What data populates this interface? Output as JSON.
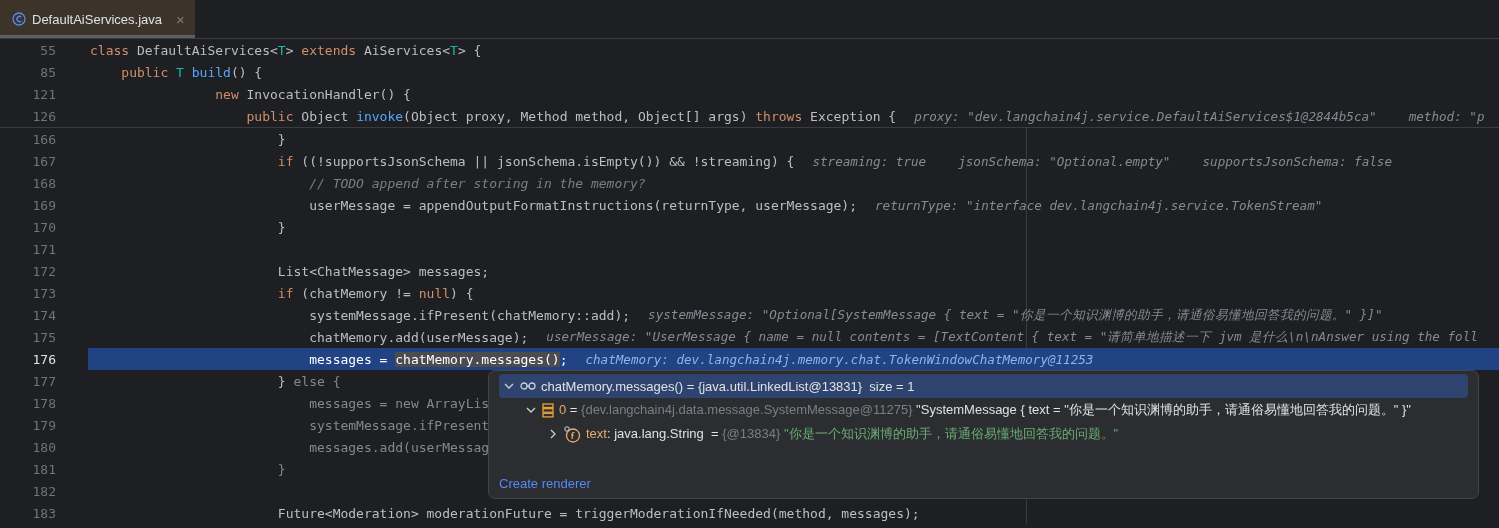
{
  "tab": {
    "title": "DefaultAiServices.java",
    "close": "×",
    "selected": true
  },
  "sticky_header": [
    {
      "number": "55",
      "tokens": [
        {
          "kind": "keyword",
          "text": "class "
        },
        {
          "kind": "plain",
          "text": "DefaultAiServices<"
        },
        {
          "kind": "type",
          "text": "T"
        },
        {
          "kind": "plain",
          "text": "> "
        },
        {
          "kind": "keyword",
          "text": "extends "
        },
        {
          "kind": "plain",
          "text": "AiServices<"
        },
        {
          "kind": "type",
          "text": "T"
        },
        {
          "kind": "plain",
          "text": "> {"
        }
      ]
    },
    {
      "number": "85",
      "tokens": [
        {
          "kind": "keyword",
          "text": "    public "
        },
        {
          "kind": "type",
          "text": "T "
        },
        {
          "kind": "method",
          "text": "build"
        },
        {
          "kind": "plain",
          "text": "() {"
        }
      ]
    },
    {
      "number": "121",
      "tokens": [
        {
          "kind": "keyword",
          "text": "                new "
        },
        {
          "kind": "plain",
          "text": "InvocationHandler() {"
        }
      ]
    },
    {
      "number": "126",
      "tokens": [
        {
          "kind": "keyword",
          "text": "                    public "
        },
        {
          "kind": "plain",
          "text": "Object "
        },
        {
          "kind": "method",
          "text": "invoke"
        },
        {
          "kind": "plain",
          "text": "(Object proxy, Method method, Object[] args) "
        },
        {
          "kind": "keyword",
          "text": "throws "
        },
        {
          "kind": "plain",
          "text": "Exception {"
        }
      ],
      "hints": [
        "proxy: \"dev.langchain4j.service.DefaultAiServices$1@2844b5ca\"",
        "method: \"p"
      ]
    }
  ],
  "lines": [
    {
      "number": "166",
      "selected": false,
      "tokens": [
        {
          "kind": "plain",
          "text": "                        }"
        }
      ]
    },
    {
      "number": "167",
      "selected": false,
      "tokens": [
        {
          "kind": "keyword",
          "text": "                        if "
        },
        {
          "kind": "plain",
          "text": "((!supportsJsonSchema || jsonSchema.isEmpty()) && !streaming) {"
        }
      ],
      "hints": [
        "streaming: true",
        "jsonSchema: \"Optional.empty\"",
        "supportsJsonSchema: false"
      ]
    },
    {
      "number": "168",
      "selected": false,
      "tokens": [
        {
          "kind": "comment",
          "text": "                            // TODO append after storing in the memory?"
        }
      ]
    },
    {
      "number": "169",
      "selected": false,
      "tokens": [
        {
          "kind": "plain",
          "text": "                            userMessage = appendOutputFormatInstructions(returnType, userMessage);"
        }
      ],
      "hints": [
        "returnType: \"interface dev.langchain4j.service.TokenStream\""
      ]
    },
    {
      "number": "170",
      "selected": false,
      "tokens": [
        {
          "kind": "plain",
          "text": "                        }"
        }
      ]
    },
    {
      "number": "171",
      "selected": false
    },
    {
      "number": "172",
      "selected": false,
      "tokens": [
        {
          "kind": "plain",
          "text": "                        List<ChatMessage> messages;"
        }
      ]
    },
    {
      "number": "173",
      "selected": false,
      "tokens": [
        {
          "kind": "keyword",
          "text": "                        if "
        },
        {
          "kind": "plain",
          "text": "(chatMemory != "
        },
        {
          "kind": "keyword",
          "text": "null"
        },
        {
          "kind": "plain",
          "text": ") {"
        }
      ]
    },
    {
      "number": "174",
      "selected": false,
      "tokens": [
        {
          "kind": "plain",
          "text": "                            systemMessage.ifPresent(chatMemory::add);"
        }
      ],
      "hints": [
        "systemMessage: \"Optional[SystemMessage { text = \"你是一个知识渊博的助手，请通俗易懂地回答我的问题。\" }]\""
      ]
    },
    {
      "number": "175",
      "selected": false,
      "tokens": [
        {
          "kind": "plain",
          "text": "                            chatMemory.add(userMessage);"
        }
      ],
      "hints": [
        "userMessage: \"UserMessage { name = null contents = [TextContent { text = \"请简单地描述一下 jvm 是什么\\n\\nAnswer using the foll"
      ]
    },
    {
      "number": "176",
      "selected": true,
      "tokens": [
        {
          "kind": "plain",
          "text": "                            messages = "
        },
        {
          "kind": "highlight",
          "text": "chatMemory.messages()"
        },
        {
          "kind": "plain",
          "text": ";"
        }
      ],
      "hints": [
        "chatMemory: dev.langchain4j.memory.chat.TokenWindowChatMemory@11253"
      ]
    },
    {
      "number": "177",
      "selected": false,
      "tokens": [
        {
          "kind": "plain",
          "text": "                        } "
        },
        {
          "kind": "inactive",
          "text": "else {"
        }
      ]
    },
    {
      "number": "178",
      "selected": false,
      "tokens": [
        {
          "kind": "inactive",
          "text": "                            messages = new ArrayLis"
        }
      ]
    },
    {
      "number": "179",
      "selected": false,
      "tokens": [
        {
          "kind": "inactive",
          "text": "                            systemMessage.ifPresent"
        }
      ]
    },
    {
      "number": "180",
      "selected": false,
      "tokens": [
        {
          "kind": "inactive",
          "text": "                            messages.add(userMessag"
        }
      ]
    },
    {
      "number": "181",
      "selected": false,
      "tokens": [
        {
          "kind": "inactive",
          "text": "                        }"
        }
      ]
    },
    {
      "number": "182",
      "selected": false
    },
    {
      "number": "183",
      "selected": false,
      "tokens": [
        {
          "kind": "plain",
          "text": "                        Future<Moderation> moderationFuture = triggerModerationIfNeeded(method, messages);"
        }
      ]
    }
  ],
  "debug_popup": {
    "variables": [
      {
        "kind": "watch",
        "selected": true,
        "expanded": true,
        "parts": [
          {
            "kind": "plain",
            "text": "chatMemory.messages() = {java.util.LinkedList@13831}  size = 1"
          }
        ],
        "children": [
          {
            "kind": "element",
            "selected": false,
            "expanded": true,
            "parts": [
              {
                "kind": "field",
                "text": "0"
              },
              {
                "kind": "plain",
                "text": " = "
              },
              {
                "kind": "ref",
                "text": "{dev.langchain4j.data.message.SystemMessage@11275} "
              },
              {
                "kind": "plain",
                "text": "\"SystemMessage { text = \"你是一个知识渊博的助手，请通俗易懂地回答我的问题。\" }\""
              }
            ],
            "children": [
              {
                "kind": "field",
                "selected": false,
                "expanded": false,
                "parts": [
                  {
                    "kind": "field",
                    "text": "text"
                  },
                  {
                    "kind": "plain",
                    "text": ": java.lang.String  = "
                  },
                  {
                    "kind": "ref",
                    "text": "{@13834} "
                  },
                  {
                    "kind": "string",
                    "text": "\"你是一个知识渊博的助手，请通俗易懂地回答我的问题。\""
                  }
                ]
              }
            ]
          }
        ]
      }
    ],
    "link": "Create renderer"
  }
}
